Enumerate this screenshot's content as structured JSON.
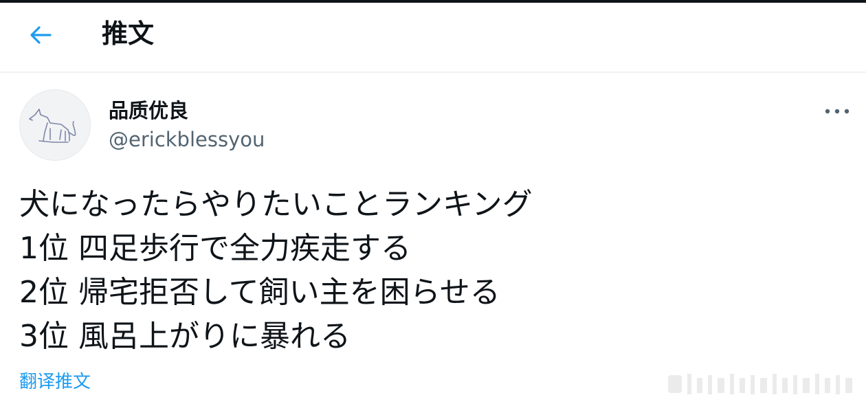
{
  "header": {
    "back_icon": "arrow-left-icon",
    "title": "推文"
  },
  "tweet": {
    "author": {
      "display_name": "品质优良",
      "handle": "@erickblessyou",
      "avatar_icon": "dog-sketch-avatar"
    },
    "more_icon": "more-horizontal-icon",
    "lines": [
      "犬になったらやりたいことランキング",
      "1位 四足歩行で全力疾走する",
      "2位 帰宅拒否して飼い主を困らせる",
      "3位 風呂上がりに暴れる"
    ],
    "translate_label": "翻译推文"
  },
  "colors": {
    "link": "#1d9bf0",
    "secondary_text": "#536471",
    "primary_text": "#0f1419"
  }
}
